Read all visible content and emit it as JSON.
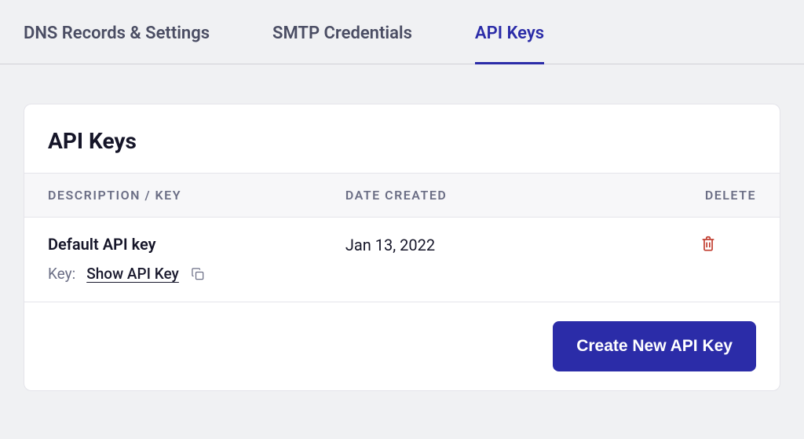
{
  "tabs": [
    {
      "label": "DNS Records & Settings",
      "active": false
    },
    {
      "label": "SMTP Credentials",
      "active": false
    },
    {
      "label": "API Keys",
      "active": true
    }
  ],
  "card": {
    "title": "API Keys",
    "columns": {
      "description": "DESCRIPTION / KEY",
      "date": "DATE CREATED",
      "delete": "DELETE"
    },
    "row": {
      "description": "Default API key",
      "key_label": "Key:",
      "show_link": "Show API Key",
      "date_created": "Jan 13, 2022"
    },
    "create_button": "Create New API Key"
  }
}
